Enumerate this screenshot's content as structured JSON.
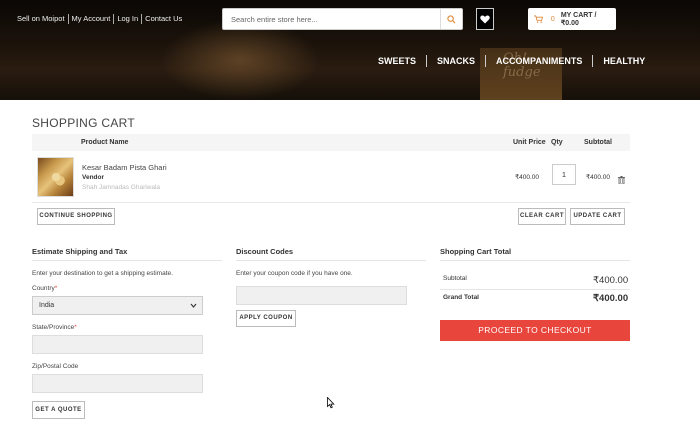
{
  "header": {
    "top_links": [
      "Sell on Moipot",
      "My Account",
      "Log In",
      "Contact Us"
    ],
    "search_placeholder": "Search entire store here...",
    "cart_count": "0",
    "cart_label": "MY CART / ₹0.00",
    "nav": [
      "SWEETS",
      "SNACKS",
      "ACCOMPANIMENTS",
      "HEALTHY"
    ]
  },
  "cart": {
    "title": "SHOPPING CART",
    "columns": {
      "product": "Product Name",
      "price": "Unit Price",
      "qty": "Qty",
      "subtotal": "Subtotal"
    },
    "items": [
      {
        "name": "Kesar Badam Pista Ghari",
        "vendor_label": "Vendor",
        "vendor": "Shah Jamnadas Ghariwala",
        "price": "₹400.00",
        "qty": "1",
        "subtotal": "₹400.00"
      }
    ],
    "buttons": {
      "continue": "CONTINUE SHOPPING",
      "clear": "CLEAR CART",
      "update": "UPDATE CART"
    }
  },
  "shipping": {
    "title": "Estimate Shipping and Tax",
    "help": "Enter your destination to get a shipping estimate.",
    "country_label": "Country",
    "country_value": "India",
    "state_label": "State/Province",
    "zip_label": "Zip/Postal Code",
    "quote_button": "GET A QUOTE"
  },
  "discount": {
    "title": "Discount Codes",
    "help": "Enter your coupon code if you have one.",
    "apply_button": "APPLY COUPON"
  },
  "totals": {
    "title": "Shopping Cart Total",
    "subtotal_label": "Subtotal",
    "subtotal_value": "₹400.00",
    "grand_label": "Grand Total",
    "grand_value": "₹400.00",
    "checkout_button": "PROCEED TO CHECKOUT"
  },
  "colors": {
    "accent": "#e8453c",
    "cart_count": "#e0893a"
  }
}
